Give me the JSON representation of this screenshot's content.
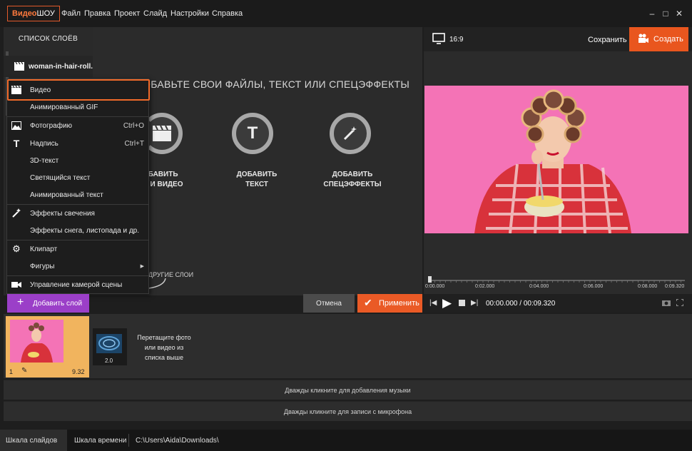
{
  "app": {
    "logo_part1": "Видео",
    "logo_part2": "ШОУ",
    "menu": [
      "Файл",
      "Правка",
      "Проект",
      "Слайд",
      "Настройки",
      "Справка"
    ],
    "window_controls": [
      "minimize-icon",
      "maximize-icon",
      "close-icon"
    ]
  },
  "layers_panel": {
    "title": "СПИСОК СЛОЁВ",
    "layer_name": "woman-in-hair-roll..."
  },
  "center": {
    "headline": "ОБАВЬТЕ СВОИ ФАЙЛЫ, ТЕКСТ ИЛИ СПЕЦЭФФЕКТЫ",
    "actions": [
      {
        "line1": "ОБАВИТЬ",
        "line2": "О И ВИДЕО",
        "icon": "clapperboard-icon"
      },
      {
        "line1": "ДОБАВИТЬ",
        "line2": "ТЕКСТ",
        "icon": "text-icon"
      },
      {
        "line1": "ДОБАВИТЬ",
        "line2": "СПЕЦЭФФЕКТЫ",
        "icon": "magic-wand-icon"
      }
    ],
    "other_layers": "ДРУГИЕ СЛОИ"
  },
  "dropdown": {
    "items": [
      {
        "label": "Видео",
        "icon": "clapperboard-icon",
        "shortcut": ""
      },
      {
        "label": "Анимированный GIF",
        "icon": "",
        "shortcut": ""
      },
      {
        "label": "Фотографию",
        "icon": "image-icon",
        "shortcut": "Ctrl+O"
      },
      {
        "label": "Надпись",
        "icon": "text-icon",
        "shortcut": "Ctrl+T"
      },
      {
        "label": "3D-текст",
        "icon": "",
        "shortcut": ""
      },
      {
        "label": "Светящийся текст",
        "icon": "",
        "shortcut": ""
      },
      {
        "label": "Анимированный текст",
        "icon": "",
        "shortcut": ""
      },
      {
        "label": "Эффекты свечения",
        "icon": "magic-wand-icon",
        "shortcut": ""
      },
      {
        "label": "Эффекты снега, листопада и др.",
        "icon": "",
        "shortcut": ""
      },
      {
        "label": "Клипарт",
        "icon": "gear-icon",
        "shortcut": ""
      },
      {
        "label": "Фигуры",
        "icon": "",
        "shortcut": ""
      },
      {
        "label": "Управление камерой сцены",
        "icon": "camera-icon",
        "shortcut": ""
      }
    ]
  },
  "buttons": {
    "add_layer": "Добавить слой",
    "cancel": "Отмена",
    "apply": "Применить"
  },
  "preview": {
    "aspect": "16:9",
    "save": "Сохранить",
    "create": "Создать",
    "ruler_labels": [
      "0:00.000",
      "0:02.000",
      "0:04.000",
      "0:06.000",
      "0:08.000",
      "0:09.320"
    ],
    "timecode": "00:00.000 / 00:09.320"
  },
  "slides": {
    "slide1_number": "1",
    "slide1_duration": "9.32",
    "transition_duration": "2.0",
    "drop_hint": "Перетащите фото или видео из списка выше"
  },
  "tracks": {
    "music": "Дважды кликните для добавления музыки",
    "mic": "Дважды кликните для записи с микрофона"
  },
  "bottom": {
    "tab_slides": "Шкала слайдов",
    "tab_time": "Шкала времени",
    "path": "C:\\Users\\Aida\\Downloads\\"
  },
  "colors": {
    "accent_orange": "#ea5a26",
    "purple": "#9b3fc8",
    "preview_pink": "#f473b6"
  }
}
